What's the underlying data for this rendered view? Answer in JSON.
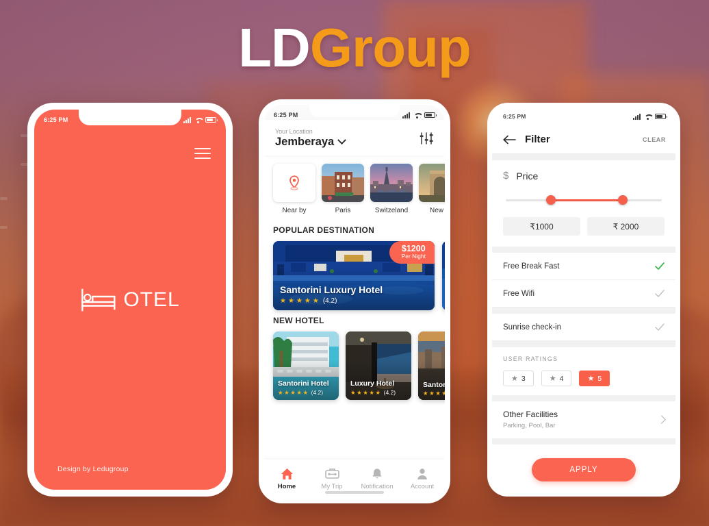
{
  "title": {
    "part1": "LD",
    "part2": "Group"
  },
  "colors": {
    "accent": "#fa6450",
    "brand_orange": "#f59b1a",
    "star": "#f5b51c",
    "check_on": "#3cb54a",
    "check_off": "#c3c3c3"
  },
  "phone1": {
    "status": {
      "time": "6:25 PM"
    },
    "menu_icon": "hamburger-icon",
    "logo": {
      "icon": "bed-icon",
      "text": "OTEL"
    },
    "credit": "Design by Ledugroup"
  },
  "phone2": {
    "status": {
      "time": "6:25 PM"
    },
    "header": {
      "label": "Your Location",
      "city": "Jemberaya",
      "filter_icon": "sliders-icon"
    },
    "destinations": [
      {
        "label": "Near by",
        "icon": "map-pin-icon"
      },
      {
        "label": "Paris"
      },
      {
        "label": "Switzeland"
      },
      {
        "label": "New D"
      }
    ],
    "popular": {
      "section_title": "POPULAR DESTINATION",
      "cards": [
        {
          "name": "Santorini Luxury Hotel",
          "rating": "(4.2)",
          "stars": 5,
          "price": "$1200",
          "price_sub": "Per Night"
        }
      ]
    },
    "new_hotel": {
      "section_title": "NEW HOTEL",
      "cards": [
        {
          "name": "Santorini Hotel",
          "rating": "(4.2)",
          "stars": 5
        },
        {
          "name": "Luxury Hotel",
          "rating": "(4.2)",
          "stars": 5
        },
        {
          "name": "Santori",
          "rating": "",
          "stars": 4
        }
      ]
    },
    "tabs": [
      {
        "label": "Home",
        "icon": "home-icon",
        "active": true
      },
      {
        "label": "My Trip",
        "icon": "suitcase-icon",
        "active": false
      },
      {
        "label": "Notification",
        "icon": "bell-icon",
        "active": false
      },
      {
        "label": "Account",
        "icon": "person-icon",
        "active": false
      }
    ]
  },
  "phone3": {
    "status": {
      "time": "6:25 PM"
    },
    "appbar": {
      "back_icon": "back-arrow-icon",
      "title": "Filter",
      "clear": "CLEAR"
    },
    "price": {
      "icon": "dollar-icon",
      "label": "Price",
      "min_value": "₹1000",
      "max_value": "₹ 2000"
    },
    "amenities": [
      {
        "label": "Free Break Fast",
        "checked": true
      },
      {
        "label": "Free Wifi",
        "checked": false
      },
      {
        "label": "Sunrise check-in",
        "checked": false
      }
    ],
    "ratings": {
      "heading": "USER  RATINGS",
      "chips": [
        {
          "value": "3",
          "selected": false
        },
        {
          "value": "4",
          "selected": false
        },
        {
          "value": "5",
          "selected": true
        }
      ]
    },
    "facilities": {
      "title": "Other Facilities",
      "subtitle": "Parking, Pool, Bar",
      "chevron": "chevron-right-icon"
    },
    "apply_label": "APPLY"
  }
}
